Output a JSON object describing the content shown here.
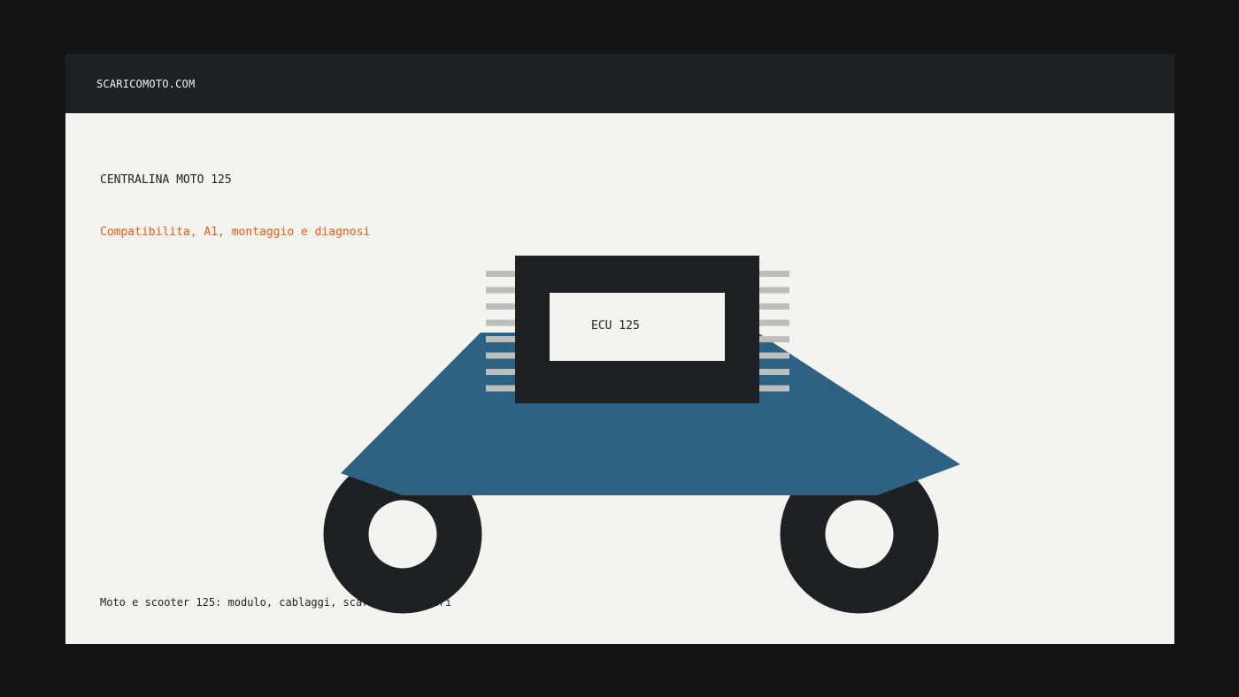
{
  "header": {
    "brand": "SCARICOMOTO.COM"
  },
  "hero": {
    "title": "CENTRALINA MOTO 125",
    "subtitle": "Compatibilita, A1, montaggio e diagnosi",
    "caption": "Moto e scooter 125: modulo, cablaggi, scarichi e filtri",
    "ecu_label": "ECU 125"
  },
  "colors": {
    "page_background": "#121416",
    "card_background": "#f3f3ef",
    "dark": "#1e2124",
    "accent": "#f05a14",
    "body_blue": "#2e6283",
    "pin_gray": "#bdbdbb"
  }
}
